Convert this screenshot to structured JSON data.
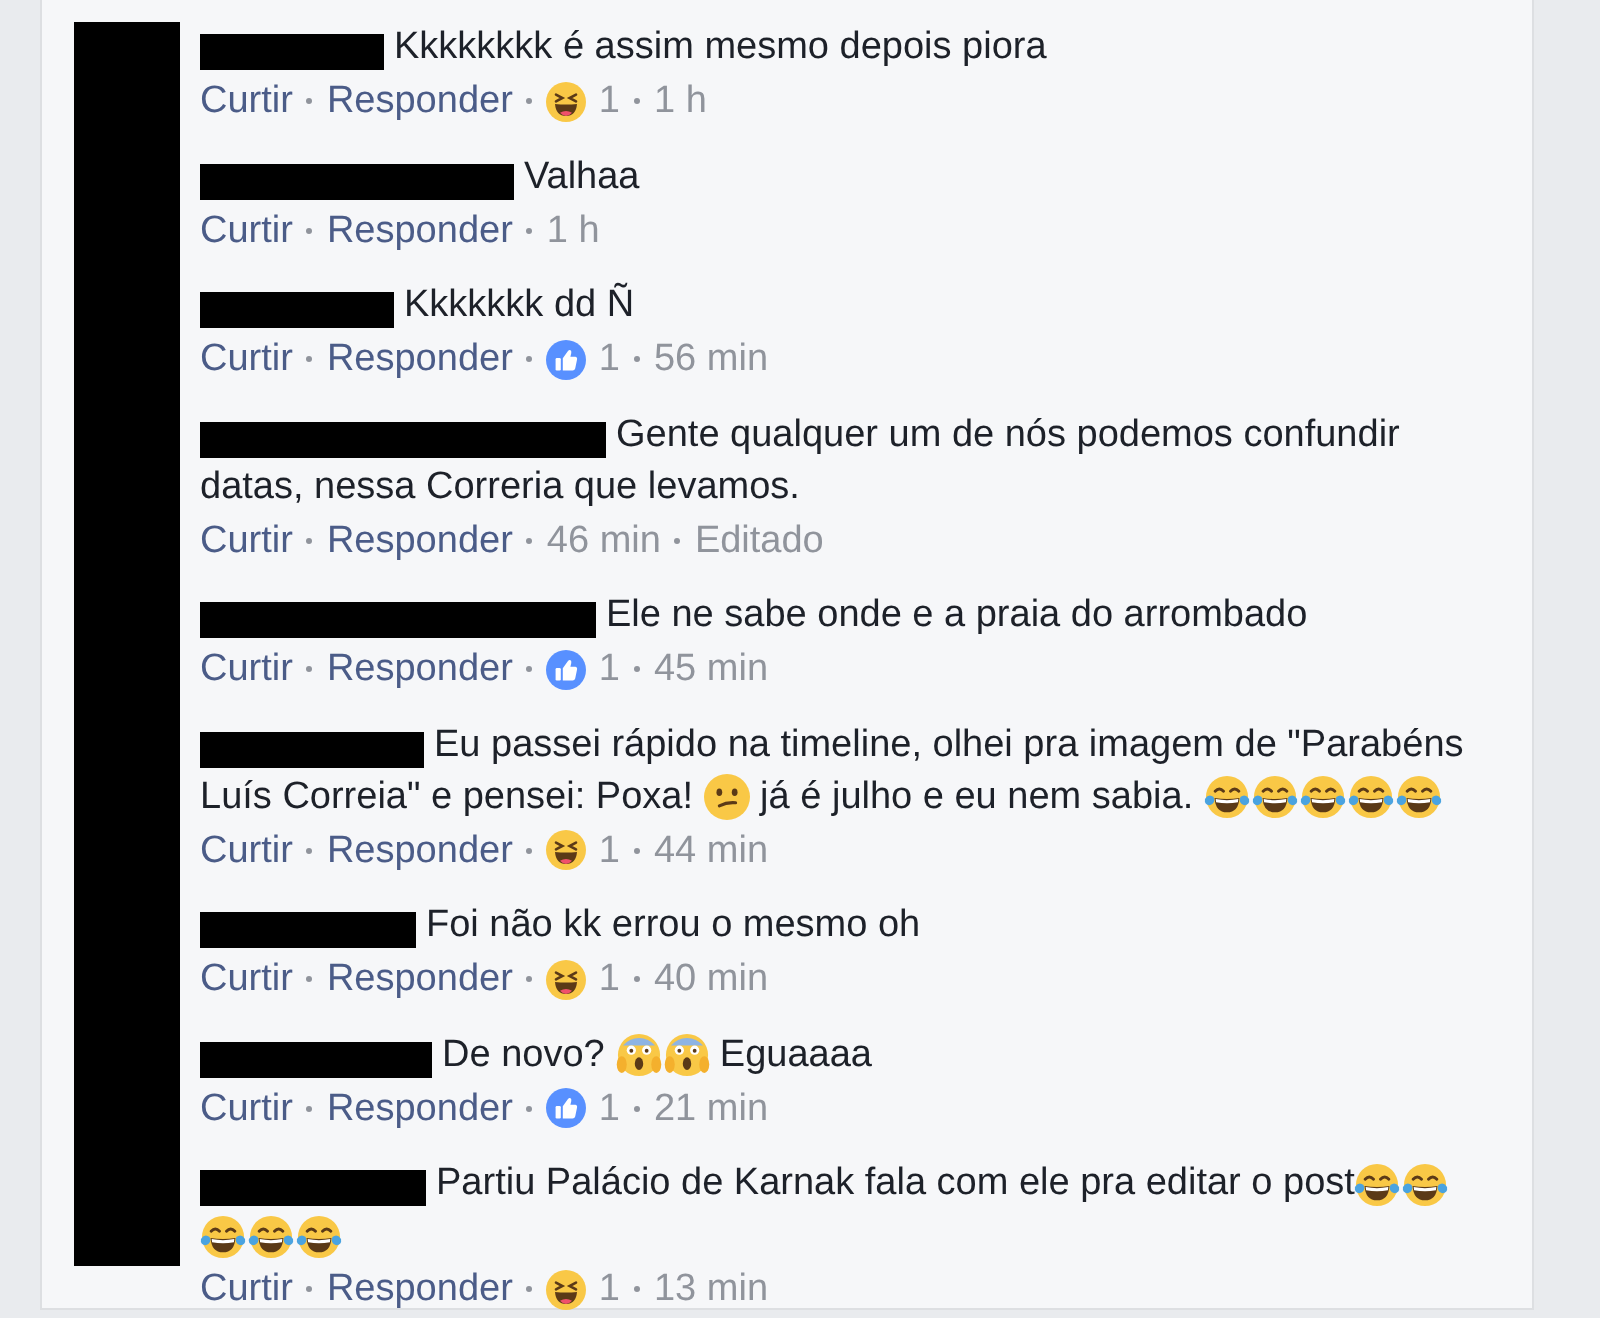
{
  "comments": [
    {
      "lines": [
        [
          {
            "kind": "text",
            "text": "Kkkkkkkk é assim mesmo depois piora"
          }
        ]
      ],
      "like_label": "Curtir",
      "reply_label": "Responder",
      "reaction": {
        "kind": "haha",
        "count": "1"
      },
      "time": "1 h"
    },
    {
      "lines": [
        [
          {
            "kind": "text",
            "text": "Valhaa"
          }
        ]
      ],
      "like_label": "Curtir",
      "reply_label": "Responder",
      "time": "1 h"
    },
    {
      "lines": [
        [
          {
            "kind": "text",
            "text": "Kkkkkkk dd Ñ"
          }
        ]
      ],
      "like_label": "Curtir",
      "reply_label": "Responder",
      "reaction": {
        "kind": "like",
        "count": "1"
      },
      "time": "56 min"
    },
    {
      "lines": [
        [
          {
            "kind": "text",
            "text": "Gente qualquer um de nós podemos confundir"
          }
        ],
        [
          {
            "kind": "text",
            "text": "datas, nessa Correria que levamos."
          }
        ]
      ],
      "like_label": "Curtir",
      "reply_label": "Responder",
      "time": "46 min",
      "edited": "Editado"
    },
    {
      "lines": [
        [
          {
            "kind": "text",
            "text": "Ele ne sabe onde e a praia do arrombado"
          }
        ]
      ],
      "like_label": "Curtir",
      "reply_label": "Responder",
      "reaction": {
        "kind": "like",
        "count": "1"
      },
      "time": "45 min"
    },
    {
      "lines": [
        [
          {
            "kind": "text",
            "text": "Eu passei rápido na timeline, olhei pra imagem de \"Parabéns"
          }
        ],
        [
          {
            "kind": "text",
            "text": "Luís Correia\" e pensei: Poxa! "
          },
          {
            "kind": "confused"
          },
          {
            "kind": "text",
            "text": " já é julho e eu nem sabia. "
          },
          {
            "kind": "tears_of_joy"
          },
          {
            "kind": "tears_of_joy"
          },
          {
            "kind": "tears_of_joy"
          },
          {
            "kind": "tears_of_joy"
          },
          {
            "kind": "tears_of_joy"
          }
        ]
      ],
      "like_label": "Curtir",
      "reply_label": "Responder",
      "reaction": {
        "kind": "haha",
        "count": "1"
      },
      "time": "44 min"
    },
    {
      "lines": [
        [
          {
            "kind": "text",
            "text": "Foi não kk errou o mesmo oh"
          }
        ]
      ],
      "like_label": "Curtir",
      "reply_label": "Responder",
      "reaction": {
        "kind": "haha",
        "count": "1"
      },
      "time": "40 min"
    },
    {
      "lines": [
        [
          {
            "kind": "text",
            "text": "De novo? "
          },
          {
            "kind": "scream"
          },
          {
            "kind": "scream"
          },
          {
            "kind": "text",
            "text": " Eguaaaa"
          }
        ]
      ],
      "like_label": "Curtir",
      "reply_label": "Responder",
      "reaction": {
        "kind": "like",
        "count": "1"
      },
      "time": "21 min"
    },
    {
      "lines": [
        [
          {
            "kind": "text",
            "text": "Partiu Palácio de Karnak fala com ele pra editar o post"
          },
          {
            "kind": "tears_of_joy"
          },
          {
            "kind": "tears_of_joy"
          }
        ],
        [
          {
            "kind": "tears_of_joy"
          },
          {
            "kind": "tears_of_joy"
          },
          {
            "kind": "tears_of_joy"
          }
        ]
      ],
      "like_label": "Curtir",
      "reply_label": "Responder",
      "reaction": {
        "kind": "haha",
        "count": "1"
      },
      "time": "13 min"
    }
  ]
}
